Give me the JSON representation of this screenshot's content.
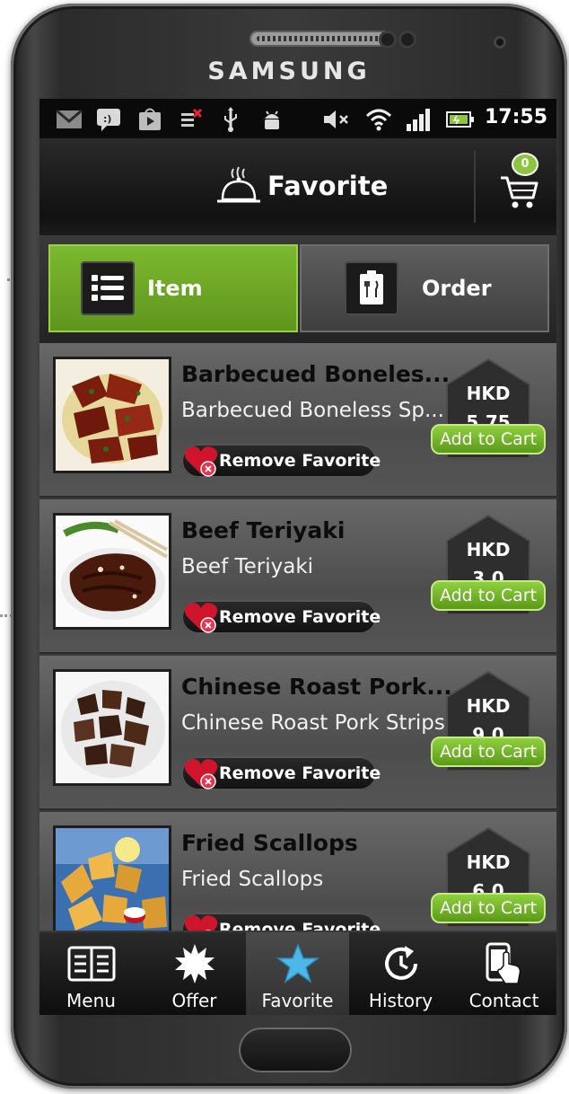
{
  "device": {
    "brand": "SAMSUNG"
  },
  "status_bar": {
    "time": "17:55",
    "icons": [
      "gmail-icon",
      "messenger-icon",
      "play-store-icon",
      "no-data-icon",
      "usb-icon",
      "android-debug-icon",
      "mute-icon",
      "wifi-icon",
      "signal-icon",
      "battery-icon"
    ]
  },
  "header": {
    "title": "Favorite",
    "cart_count": "0",
    "icon": "cloche-icon"
  },
  "tabs": [
    {
      "label": "Item",
      "icon": "list-icon",
      "active": true
    },
    {
      "label": "Order",
      "icon": "menu-card-icon",
      "active": false
    }
  ],
  "favorites": [
    {
      "name": "Barbecued Boneles...",
      "description": "Barbecued Boneless Sp...",
      "currency": "HKD",
      "price": "5.75",
      "remove_label": "Remove Favorite",
      "add_label": "Add to Cart"
    },
    {
      "name": "Beef Teriyaki",
      "description": "Beef Teriyaki",
      "currency": "HKD",
      "price": "3.0",
      "remove_label": "Remove Favorite",
      "add_label": "Add to Cart"
    },
    {
      "name": "Chinese Roast Pork...",
      "description": "Chinese Roast Pork Strips",
      "currency": "HKD",
      "price": "9.0",
      "remove_label": "Remove Favorite",
      "add_label": "Add to Cart"
    },
    {
      "name": "Fried Scallops",
      "description": "Fried Scallops",
      "currency": "HKD",
      "price": "6.0",
      "remove_label": "Remove Favorite",
      "add_label": "Add to Cart"
    }
  ],
  "bottom_nav": [
    {
      "label": "Menu",
      "icon": "menu-grid-icon",
      "active": false
    },
    {
      "label": "Offer",
      "icon": "starburst-icon",
      "active": false
    },
    {
      "label": "Favorite",
      "icon": "star-icon",
      "active": true
    },
    {
      "label": "History",
      "icon": "history-icon",
      "active": false
    },
    {
      "label": "Contact",
      "icon": "phone-touch-icon",
      "active": false
    }
  ],
  "colors": {
    "accent_green": "#7cb830",
    "star_blue": "#4db8e8",
    "heart_red": "#d0142c"
  }
}
